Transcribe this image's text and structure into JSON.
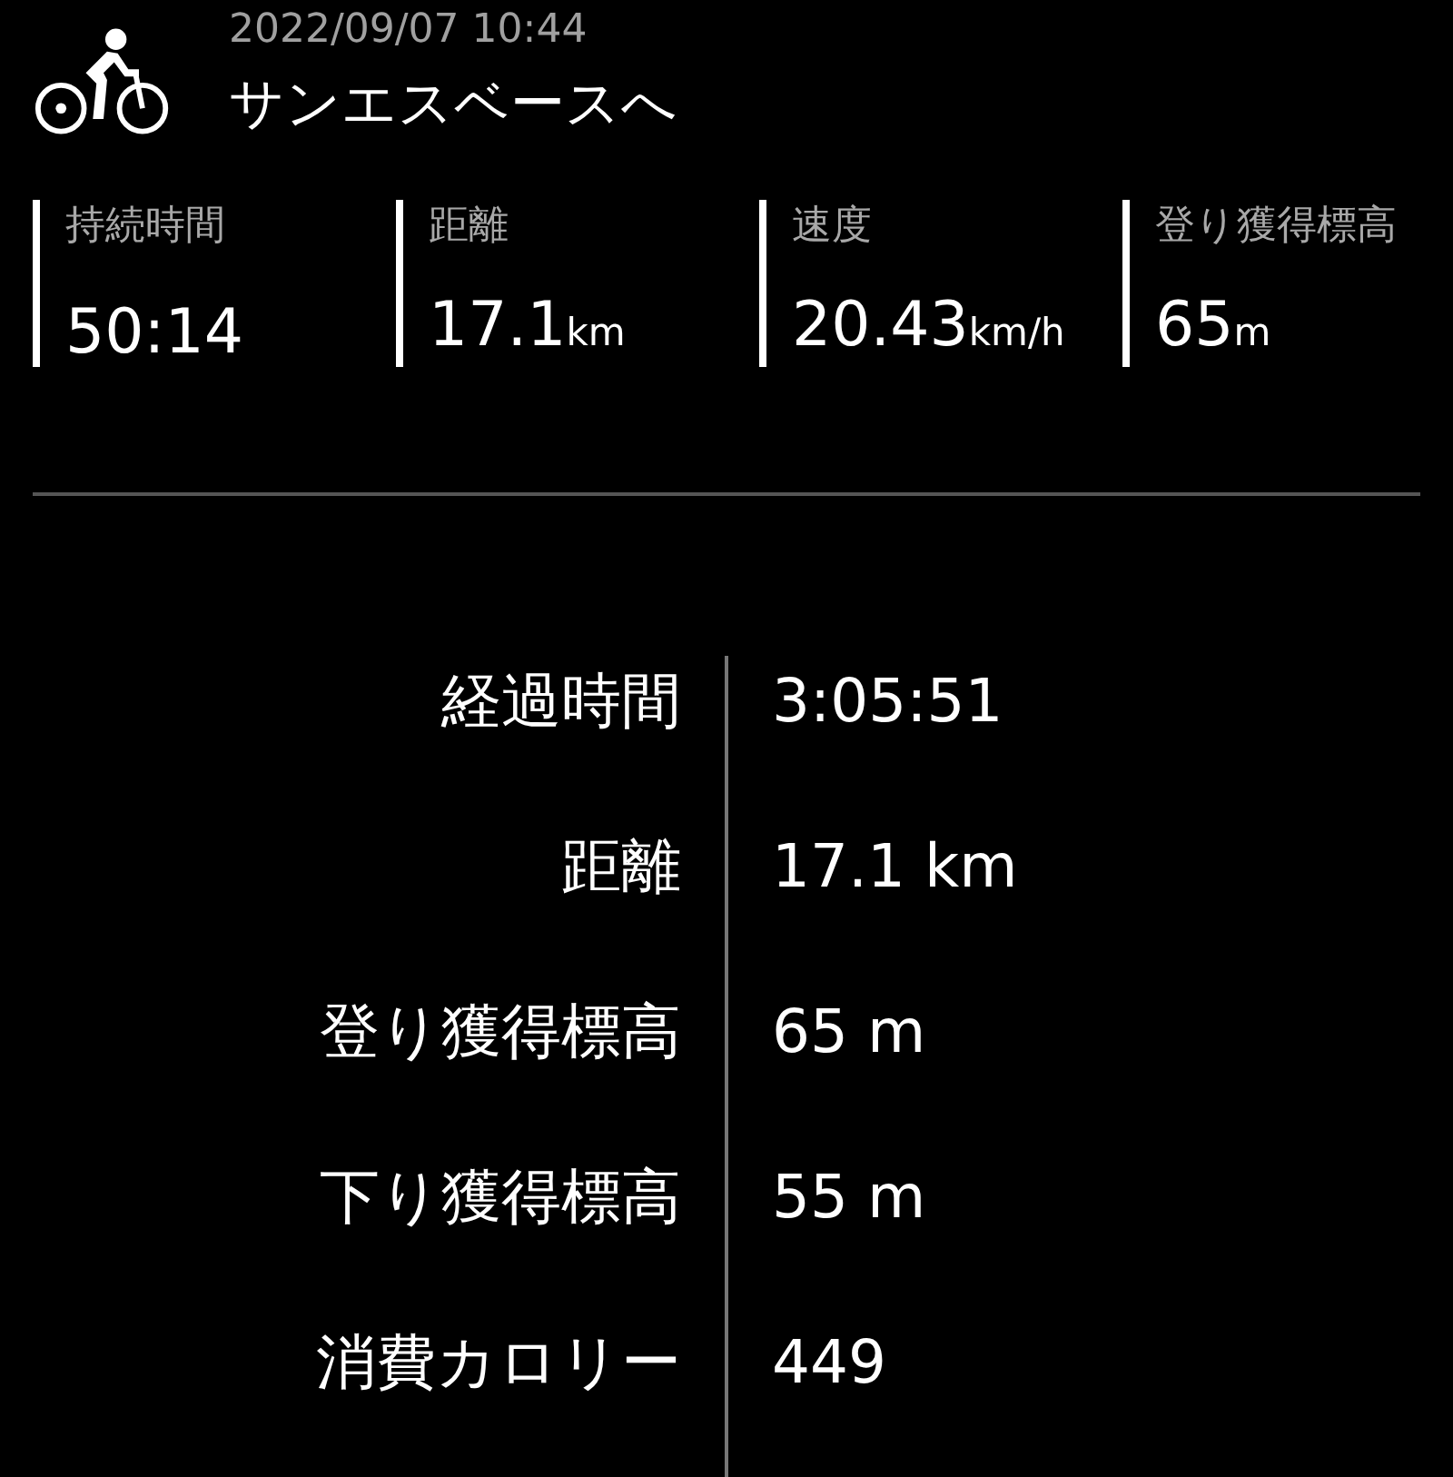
{
  "header": {
    "date": "2022/09/07 10:44",
    "title": "サンエスベースへ"
  },
  "stats": [
    {
      "label": "持続時間",
      "value": "50:14"
    },
    {
      "label": "距離",
      "value": "17.1",
      "unit": "km"
    },
    {
      "label": "速度",
      "value": "20.43",
      "unit": "km/h"
    },
    {
      "label": "登り獲得標高",
      "value": "65",
      "unit": "m"
    }
  ],
  "details": [
    {
      "label": "経過時間",
      "value": "3:05:51"
    },
    {
      "label": "距離",
      "value": "17.1 km"
    },
    {
      "label": "登り獲得標高",
      "value": "65 m"
    },
    {
      "label": "下り獲得標高",
      "value": "55 m"
    },
    {
      "label": "消費カロリー",
      "value": "449"
    }
  ]
}
